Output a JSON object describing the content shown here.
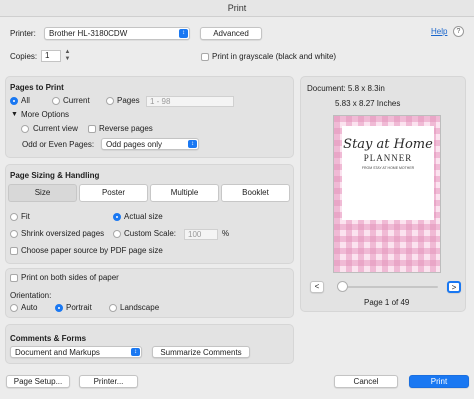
{
  "window": {
    "title": "Print"
  },
  "printer": {
    "label": "Printer:",
    "value": "Brother HL-3180CDW",
    "advanced_label": "Advanced",
    "help_label": "Help"
  },
  "copies": {
    "label": "Copies:",
    "value": "1",
    "grayscale_label": "Print in grayscale (black and white)"
  },
  "pages": {
    "heading": "Pages to Print",
    "all": "All",
    "current": "Current",
    "pages": "Pages",
    "range_placeholder": "1 - 98",
    "more_options": "More Options",
    "current_view": "Current view",
    "reverse_pages": "Reverse pages",
    "odd_even_label": "Odd or Even Pages:",
    "odd_even_value": "Odd pages only"
  },
  "sizing": {
    "heading": "Page Sizing & Handling",
    "tabs": [
      "Size",
      "Poster",
      "Multiple",
      "Booklet"
    ],
    "selected_tab": "Size",
    "fit": "Fit",
    "actual_size": "Actual size",
    "shrink_oversized": "Shrink oversized pages",
    "custom_scale": "Custom Scale:",
    "scale_value": "100",
    "percent": "%",
    "paper_source": "Choose paper source by PDF page size"
  },
  "duplex": {
    "both_sides": "Print on both sides of paper",
    "orientation_label": "Orientation:",
    "auto": "Auto",
    "portrait": "Portrait",
    "landscape": "Landscape"
  },
  "comments": {
    "heading": "Comments & Forms",
    "value": "Document and Markups",
    "summarize": "Summarize Comments"
  },
  "preview": {
    "document_size": "Document: 5.8 x 8.3in",
    "paper_size": "5.83 x 8.27 Inches",
    "title_line1": "Stay at Home",
    "title_line2": "PLANNER",
    "subtitle": "FROM STAY AT HOME MOTHER",
    "prev": "<",
    "next": ">",
    "page_status": "Page 1 of 49"
  },
  "footer": {
    "page_setup": "Page Setup...",
    "printer": "Printer...",
    "cancel": "Cancel",
    "print": "Print"
  },
  "colors": {
    "accent": "#1a78f2",
    "gingham": "#e9a6c7"
  }
}
